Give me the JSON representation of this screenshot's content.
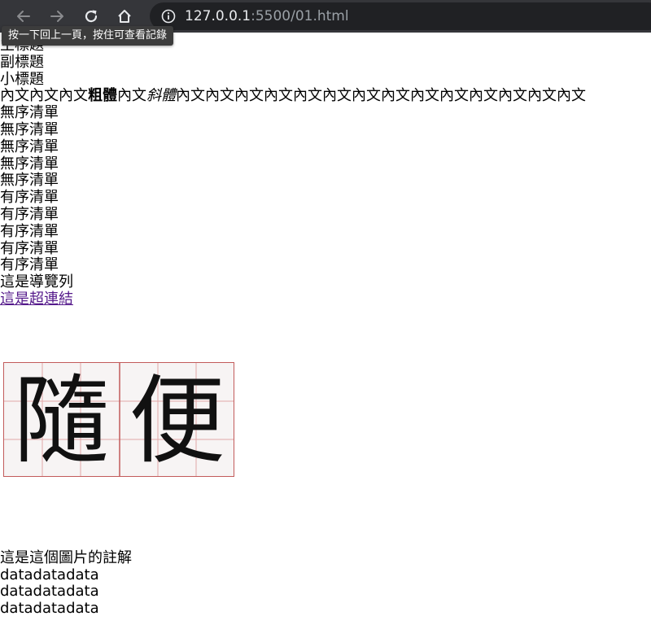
{
  "browser": {
    "url_host": "127.0.0.1",
    "url_rest": ":5500/01.html",
    "tooltip": "按一下回上一頁，按住可查看記錄",
    "icons": [
      "back-arrow-icon",
      "forward-arrow-icon",
      "reload-icon",
      "home-icon",
      "info-icon"
    ]
  },
  "page": {
    "main_title": "主標題",
    "subtitle": "副標題",
    "small_title": "小標題",
    "paragraph": {
      "part1": "內文內文內文",
      "bold": "粗體",
      "part2": "內文",
      "italic": "斜體",
      "part3": "內文內文內文內文內文內文內文內文內文內文內文內文內文內文"
    },
    "unordered_list": [
      "無序清單",
      "無序清單",
      "無序清單",
      "無序清單",
      "無序清單"
    ],
    "ordered_list": [
      "有序清單",
      "有序清單",
      "有序清單",
      "有序清單",
      "有序清單"
    ],
    "nav_text": "這是導覽列",
    "link_text": "這是超連結",
    "image": {
      "characters": [
        "隨",
        "便"
      ]
    },
    "caption": "這是這個圖片的註解",
    "data_rows": [
      "datadatadata",
      "datadatadata",
      "datadatadata"
    ]
  }
}
